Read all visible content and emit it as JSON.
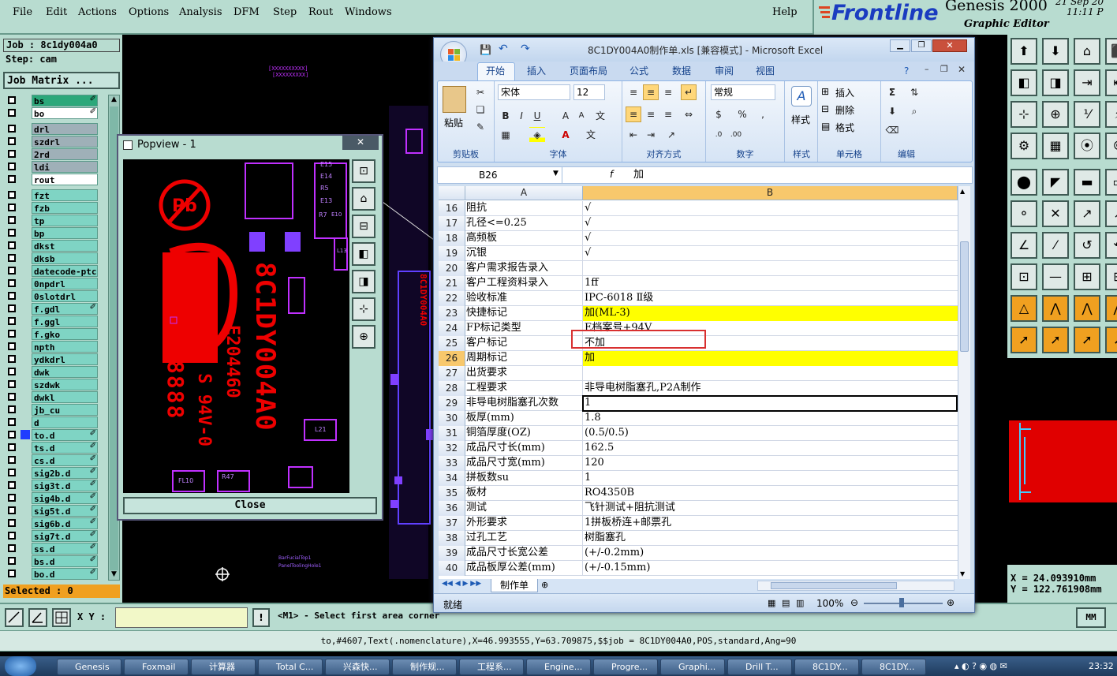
{
  "menubar": {
    "items": [
      "File",
      "Edit",
      "Actions",
      "Options",
      "Analysis",
      "DFM",
      "Step",
      "Rout",
      "Windows"
    ],
    "help": "Help"
  },
  "brand": {
    "logo": "Frontline",
    "product": "Genesis 2000",
    "subtitle": "Graphic Editor",
    "date": "21 Sep 20",
    "time": "11:11 P"
  },
  "job": {
    "job": "Job : 8c1dy004a0",
    "step": "Step: cam",
    "matrix": "Job Matrix ...",
    "selected": "Selected : 0"
  },
  "layers": [
    {
      "name": "bs",
      "style": "green",
      "mark": "✐"
    },
    {
      "name": "bo",
      "style": "white",
      "mark": "✐"
    },
    {
      "name": "drl",
      "style": "grey",
      "mark": ""
    },
    {
      "name": "szdrl",
      "style": "grey",
      "mark": ""
    },
    {
      "name": "2rd",
      "style": "grey",
      "mark": ""
    },
    {
      "name": "ldi",
      "style": "grey",
      "mark": ""
    },
    {
      "name": "rout",
      "style": "white",
      "mark": ""
    },
    {
      "name": "fzt",
      "style": "",
      "mark": ""
    },
    {
      "name": "fzb",
      "style": "",
      "mark": ""
    },
    {
      "name": "tp",
      "style": "",
      "mark": ""
    },
    {
      "name": "bp",
      "style": "",
      "mark": ""
    },
    {
      "name": "dkst",
      "style": "",
      "mark": ""
    },
    {
      "name": "dksb",
      "style": "",
      "mark": ""
    },
    {
      "name": "datecode-ptc",
      "style": "",
      "mark": ""
    },
    {
      "name": "0npdrl",
      "style": "",
      "mark": ""
    },
    {
      "name": "0slotdrl",
      "style": "",
      "mark": ""
    },
    {
      "name": "f.gdl",
      "style": "",
      "mark": "✐"
    },
    {
      "name": "f.ggl",
      "style": "",
      "mark": ""
    },
    {
      "name": "f.gko",
      "style": "",
      "mark": ""
    },
    {
      "name": "npth",
      "style": "",
      "mark": ""
    },
    {
      "name": "ydkdrl",
      "style": "",
      "mark": ""
    },
    {
      "name": "dwk",
      "style": "",
      "mark": ""
    },
    {
      "name": "szdwk",
      "style": "",
      "mark": ""
    },
    {
      "name": "dwkl",
      "style": "",
      "mark": ""
    },
    {
      "name": "jb_cu",
      "style": "",
      "mark": ""
    },
    {
      "name": "d",
      "style": "",
      "mark": ""
    },
    {
      "name": "to.d",
      "style": "",
      "mark": "✐",
      "active": true
    },
    {
      "name": "ts.d",
      "style": "",
      "mark": "✐"
    },
    {
      "name": "cs.d",
      "style": "",
      "mark": "✐"
    },
    {
      "name": "sig2b.d",
      "style": "",
      "mark": "✐"
    },
    {
      "name": "sig3t.d",
      "style": "",
      "mark": "✐"
    },
    {
      "name": "sig4b.d",
      "style": "",
      "mark": "✐"
    },
    {
      "name": "sig5t.d",
      "style": "",
      "mark": "✐"
    },
    {
      "name": "sig6b.d",
      "style": "",
      "mark": "✐"
    },
    {
      "name": "sig7t.d",
      "style": "",
      "mark": "✐"
    },
    {
      "name": "ss.d",
      "style": "",
      "mark": "✐"
    },
    {
      "name": "bs.d",
      "style": "",
      "mark": "✐"
    },
    {
      "name": "bo.d",
      "style": "",
      "mark": "✐"
    }
  ],
  "popview": {
    "title": "Popview - 1",
    "close": "Close",
    "silk": {
      "part": "8C1DY004A0",
      "ul": "E204460",
      "spec": "ML-3 S 94V-0",
      "date": "8888"
    },
    "refs": [
      "E15",
      "E14",
      "R5",
      "E13",
      "R7",
      "E10",
      "L13",
      "L21",
      "FL10",
      "R47"
    ]
  },
  "cad": {
    "labels": [
      "BarFucialTop1",
      "PanelToolingHole1"
    ],
    "coord_x": "X = 24.093910mm",
    "coord_y": "Y = 122.761908mm"
  },
  "bottom": {
    "xy_label": "X Y :",
    "xy_value": "",
    "prompt": "<M1> - Select first area corner",
    "unit": "MM"
  },
  "status": "to,#4607,Text(.nomenclature),X=46.993555,Y=63.709875,$$job = 8C1DY004A0,POS,standard,Ang=90",
  "excel": {
    "title": "8C1DY004A0制作单.xls  [兼容模式] - Microsoft Excel",
    "tabs": [
      "开始",
      "插入",
      "页面布局",
      "公式",
      "数据",
      "审阅",
      "视图"
    ],
    "font": "宋体",
    "size": "12",
    "numfmt": "常规",
    "groups": [
      "剪贴板",
      "字体",
      "对齐方式",
      "数字",
      "样式",
      "单元格",
      "编辑"
    ],
    "paste": "粘贴",
    "style": "样式",
    "insert": "插入",
    "delete": "删除",
    "format": "格式",
    "namebox": "B26",
    "formula": "加",
    "col_a": "A",
    "col_b": "B",
    "rows": [
      {
        "n": "16",
        "a": "阻抗",
        "b": "√"
      },
      {
        "n": "17",
        "a": "孔径<=0.25",
        "b": "√"
      },
      {
        "n": "18",
        "a": "高频板",
        "b": "√"
      },
      {
        "n": "19",
        "a": "沉银",
        "b": "√"
      },
      {
        "n": "20",
        "a": "客户需求报告录入",
        "b": ""
      },
      {
        "n": "21",
        "a": "客户工程资料录入",
        "b": "1ff"
      },
      {
        "n": "22",
        "a": "验收标准",
        "b": "IPC-6018 Ⅱ级"
      },
      {
        "n": "23",
        "a": "快捷标记",
        "b": "加(ML-3)",
        "yellow": true
      },
      {
        "n": "24",
        "a": "FP标记类型",
        "b": "E档案号+94V"
      },
      {
        "n": "25",
        "a": "客户标记",
        "b": "不加"
      },
      {
        "n": "26",
        "a": "周期标记",
        "b": "加",
        "yellow": true,
        "selected": true
      },
      {
        "n": "27",
        "a": "出货要求",
        "b": ""
      },
      {
        "n": "28",
        "a": "工程要求",
        "b": "非导电树脂塞孔,P2A制作"
      },
      {
        "n": "29",
        "a": "非导电树脂塞孔次数",
        "b": "1"
      },
      {
        "n": "30",
        "a": "板厚(mm)",
        "b": "1.8"
      },
      {
        "n": "31",
        "a": "铜箔厚度(OZ)",
        "b": "(0.5/0.5)"
      },
      {
        "n": "32",
        "a": "成品尺寸长(mm)",
        "b": "162.5"
      },
      {
        "n": "33",
        "a": "成品尺寸宽(mm)",
        "b": "120"
      },
      {
        "n": "34",
        "a": "拼板数su",
        "b": "1"
      },
      {
        "n": "35",
        "a": "板材",
        "b": "RO4350B"
      },
      {
        "n": "36",
        "a": "测试",
        "b": "飞针测试+阻抗测试"
      },
      {
        "n": "37",
        "a": "外形要求",
        "b": "1拼板桥连+邮票孔"
      },
      {
        "n": "38",
        "a": "过孔工艺",
        "b": "树脂塞孔"
      },
      {
        "n": "39",
        "a": "成品尺寸长宽公差",
        "b": "(+/-0.2mm)"
      },
      {
        "n": "40",
        "a": "成品板厚公差(mm)",
        "b": "(+/-0.15mm)"
      }
    ],
    "sheet": "制作单",
    "ready": "就绪",
    "zoom": "100%"
  },
  "taskbar": [
    "Genesis",
    "Foxmail",
    "计算器",
    "Total C...",
    "兴森快...",
    "制作规...",
    "工程系...",
    "Engine...",
    "Progre...",
    "Graphi...",
    "Drill T...",
    "8C1DY...",
    "8C1DY..."
  ],
  "clock": "23:32"
}
